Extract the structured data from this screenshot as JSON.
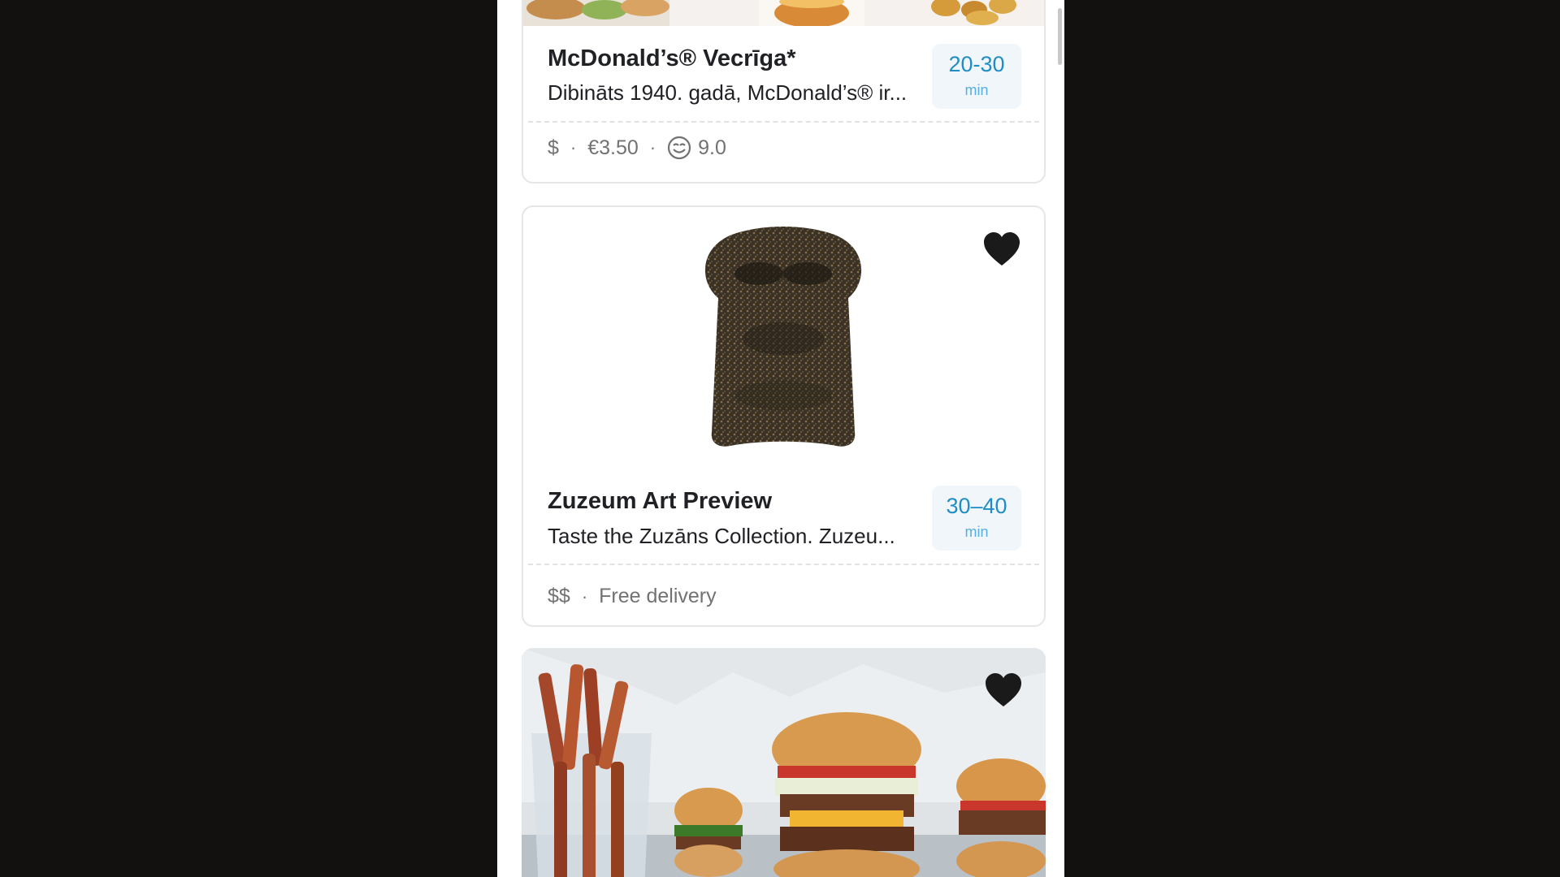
{
  "restaurants": [
    {
      "name": "McDonald’s® Vecrīga*",
      "description": "Dibināts 1940. gadā, McDonald’s® ir...",
      "eta_time": "20-30",
      "eta_unit": "min",
      "price_level": "$",
      "delivery_fee": "€3.50",
      "rating": "9.0",
      "rating_icon": "smiley-face-icon"
    },
    {
      "name": "Zuzeum Art Preview",
      "description": "Taste the Zuzāns Collection. Zuzeu...",
      "eta_time": "30–40",
      "eta_unit": "min",
      "price_level": "$$",
      "delivery_info": "Free delivery",
      "favorite_icon": "heart-icon"
    },
    {
      "favorite_icon": "heart-icon"
    }
  ],
  "separator": "·",
  "colors": {
    "eta_text": "#1f8ec6",
    "eta_bg": "#f0f6fa",
    "background": "#121110"
  }
}
